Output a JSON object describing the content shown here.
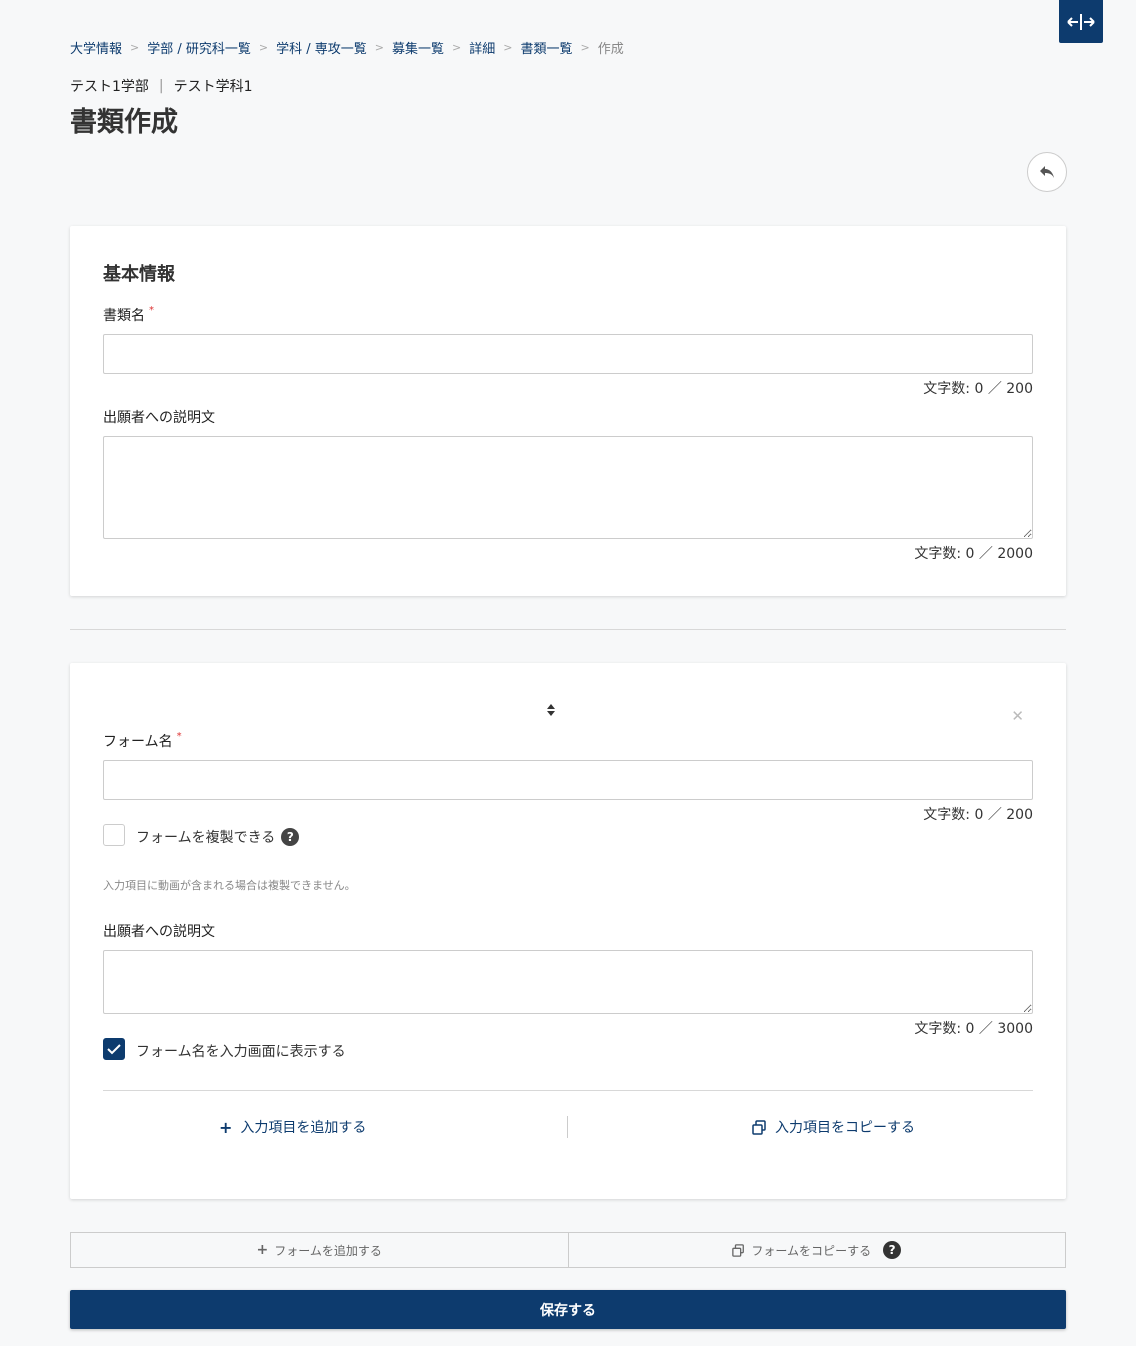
{
  "breadcrumb": {
    "items": [
      "大学情報",
      "学部 / 研究科一覧",
      "学科 / 専攻一覧",
      "募集一覧",
      "詳細",
      "書類一覧"
    ],
    "current": "作成"
  },
  "header": {
    "faculty": "テスト1学部",
    "department": "テスト学科1",
    "title": "書類作成"
  },
  "basic_info": {
    "section_title": "基本情報",
    "doc_name_label": "書類名",
    "doc_name_value": "",
    "doc_name_counter": "文字数: 0 ／ 200",
    "desc_label": "出願者への説明文",
    "desc_value": "",
    "desc_counter": "文字数: 0 ／ 2000"
  },
  "form_block": {
    "form_name_label": "フォーム名",
    "form_name_value": "",
    "form_name_counter": "文字数: 0 ／ 200",
    "duplicable_label": "フォームを複製できる",
    "duplicable_checked": false,
    "duplicable_note": "入力項目に動画が含まれる場合は複製できません。",
    "desc_label": "出願者への説明文",
    "desc_value": "",
    "desc_counter": "文字数: 0 ／ 3000",
    "show_name_label": "フォーム名を入力画面に表示する",
    "show_name_checked": true,
    "add_item_label": "入力項目を追加する",
    "copy_item_label": "入力項目をコピーする"
  },
  "bottom": {
    "add_form_label": "フォームを追加する",
    "copy_form_label": "フォームをコピーする",
    "save_label": "保存する"
  },
  "colors": {
    "primary": "#0d3b6e",
    "background": "#f7f8f9",
    "required": "#d33333"
  },
  "icons": [
    "expand-horizontal-icon",
    "undo-icon",
    "sort-icon",
    "close-icon",
    "help-icon",
    "plus-icon",
    "copy-icon",
    "check-icon"
  ]
}
